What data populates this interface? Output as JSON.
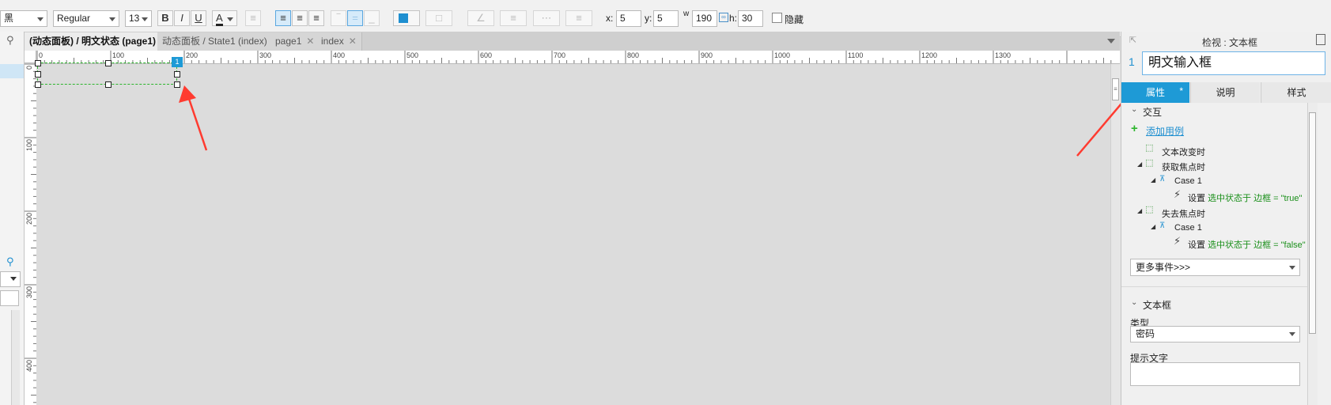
{
  "toolbar": {
    "font_family": "黑",
    "font_weight": "Regular",
    "font_size": "13",
    "bold": "B",
    "italic": "I",
    "underline": "U",
    "font_color": "A",
    "x_label": "x:",
    "x_value": "5",
    "y_label": "y:",
    "y_value": "5",
    "w_label": "w",
    "w_value": "190",
    "h_label": "h:",
    "h_value": "30",
    "hide_label": "隐藏"
  },
  "tabs": [
    {
      "label": "(动态面板) / 明文状态 (page1)",
      "active": true
    },
    {
      "label": "动态面板 / State1 (index)"
    },
    {
      "label": "page1"
    },
    {
      "label": "index"
    }
  ],
  "ruler": {
    "h_ticks": [
      "0",
      "100",
      "200",
      "300",
      "400",
      "500",
      "600",
      "700",
      "800",
      "900",
      "1000",
      "1100",
      "1200",
      "1300"
    ],
    "v_ticks": [
      "0",
      "100",
      "200",
      "300",
      "400"
    ]
  },
  "widget": {
    "badge": "1"
  },
  "inspector": {
    "header": "检视 : 文本框",
    "index": "1",
    "name": "明文输入框",
    "tabs": [
      "属性",
      "说明",
      "样式"
    ],
    "star": "*",
    "interaction_title": "交互",
    "add_case": "添加用例",
    "events": [
      {
        "label": "文本改变时"
      },
      {
        "label": "获取焦点时"
      },
      {
        "label": "Case 1"
      },
      {
        "label": "设置",
        "detail": "选中状态于 边框 = \"true\""
      },
      {
        "label": "失去焦点时"
      },
      {
        "label": "Case 1"
      },
      {
        "label": "设置",
        "detail": "选中状态于 边框 = \"false\""
      }
    ],
    "more_events": "更多事件>>>",
    "textbox_title": "文本框",
    "type_label": "类型",
    "type_value": "密码",
    "hint_label": "提示文字"
  },
  "colors": {
    "accent": "#1e9ad6",
    "selection": "#2db52d",
    "annotation": "#ff3b30"
  }
}
